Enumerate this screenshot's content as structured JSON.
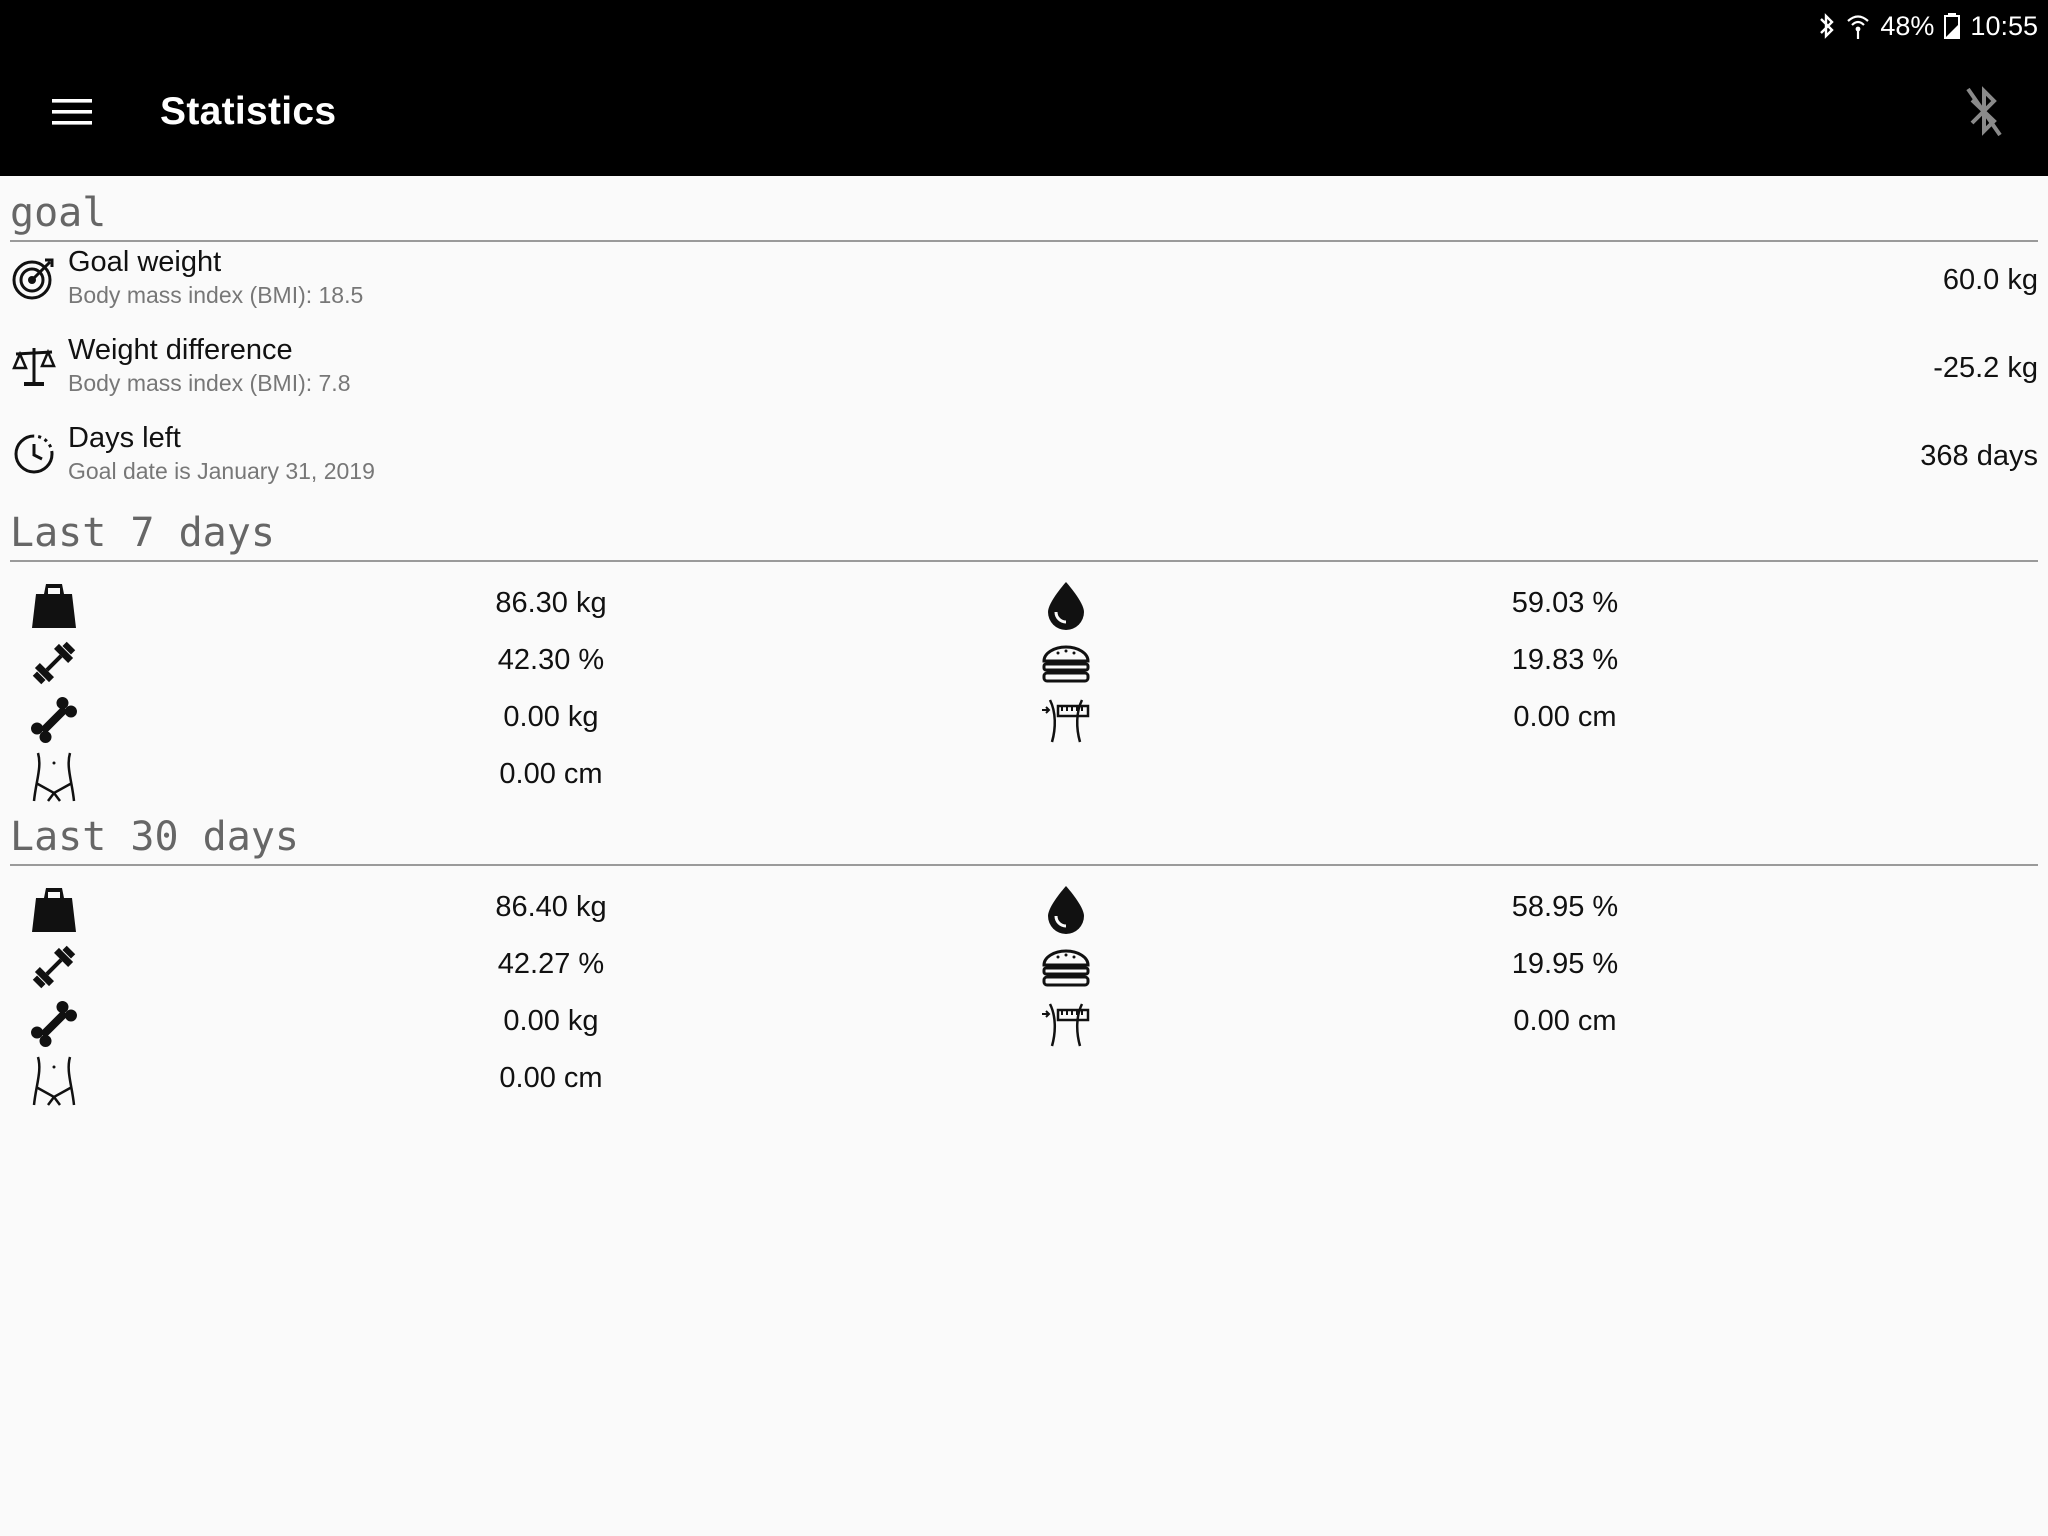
{
  "status_bar": {
    "battery_percent": "48%",
    "time": "10:55",
    "icons": [
      "bluetooth-icon",
      "wifi-icon",
      "battery-icon"
    ]
  },
  "app_bar": {
    "title": "Statistics",
    "icons": [
      "menu-icon",
      "bluetooth-disabled-icon"
    ]
  },
  "goal": {
    "header": "goal",
    "rows": [
      {
        "icon": "target-icon",
        "title": "Goal weight",
        "subtitle": "Body mass index (BMI): 18.5",
        "value": "60.0 kg"
      },
      {
        "icon": "scale-balance-icon",
        "title": "Weight difference",
        "subtitle": "Body mass index (BMI): 7.8",
        "value": "-25.2 kg"
      },
      {
        "icon": "clock-icon",
        "title": "Days left",
        "subtitle": "Goal date is January 31, 2019",
        "value": "368 days"
      }
    ]
  },
  "last7": {
    "header": "Last 7 days",
    "weight": "86.30 kg",
    "water": "59.03 %",
    "muscle": "42.30 %",
    "fat": "19.83 %",
    "bone": "0.00 kg",
    "waist": "0.00 cm",
    "hip": "0.00 cm"
  },
  "last30": {
    "header": "Last 30 days",
    "weight": "86.40 kg",
    "water": "58.95 %",
    "muscle": "42.27 %",
    "fat": "19.95 %",
    "bone": "0.00 kg",
    "waist": "0.00 cm",
    "hip": "0.00 cm"
  }
}
